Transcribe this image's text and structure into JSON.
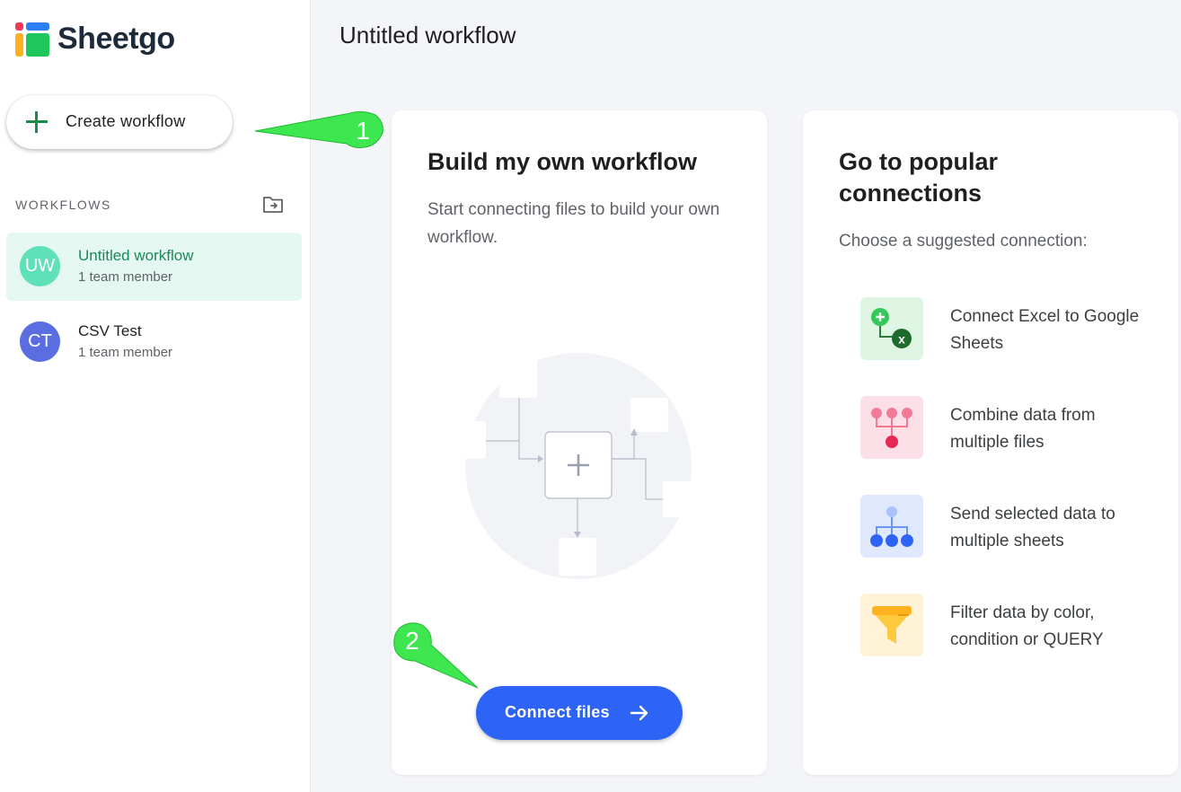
{
  "brand": {
    "name": "Sheetgo"
  },
  "sidebar": {
    "create_label": "Create workflow",
    "section_title": "WORKFLOWS",
    "workflows": [
      {
        "initials": "UW",
        "name": "Untitled workflow",
        "members": "1 team member",
        "color": "#5fe0b9",
        "active": true
      },
      {
        "initials": "CT",
        "name": "CSV Test",
        "members": "1 team member",
        "color": "#5b6ee1",
        "active": false
      }
    ]
  },
  "main": {
    "title": "Untitled workflow",
    "build": {
      "heading": "Build my own workflow",
      "description": "Start connecting files to build your own workflow.",
      "button_label": "Connect files"
    },
    "popular": {
      "heading": "Go to popular connections",
      "subtitle": "Choose a suggested connection:",
      "items": [
        {
          "label": "Connect Excel to Google Sheets",
          "icon": "excel-to-sheets-icon",
          "bg": "#def5e3"
        },
        {
          "label": "Combine data from multiple files",
          "icon": "combine-data-icon",
          "bg": "#fde0e7"
        },
        {
          "label": "Send selected data to multiple sheets",
          "icon": "split-data-icon",
          "bg": "#dfe8fd"
        },
        {
          "label": "Filter data by color, condition or QUERY",
          "icon": "filter-icon",
          "bg": "#fff2d6"
        }
      ]
    }
  },
  "annotations": {
    "step1": "1",
    "step2": "2"
  },
  "colors": {
    "primary_button": "#2e64f5",
    "accent_green": "#1a8a48",
    "callout_green": "#3ee650"
  }
}
